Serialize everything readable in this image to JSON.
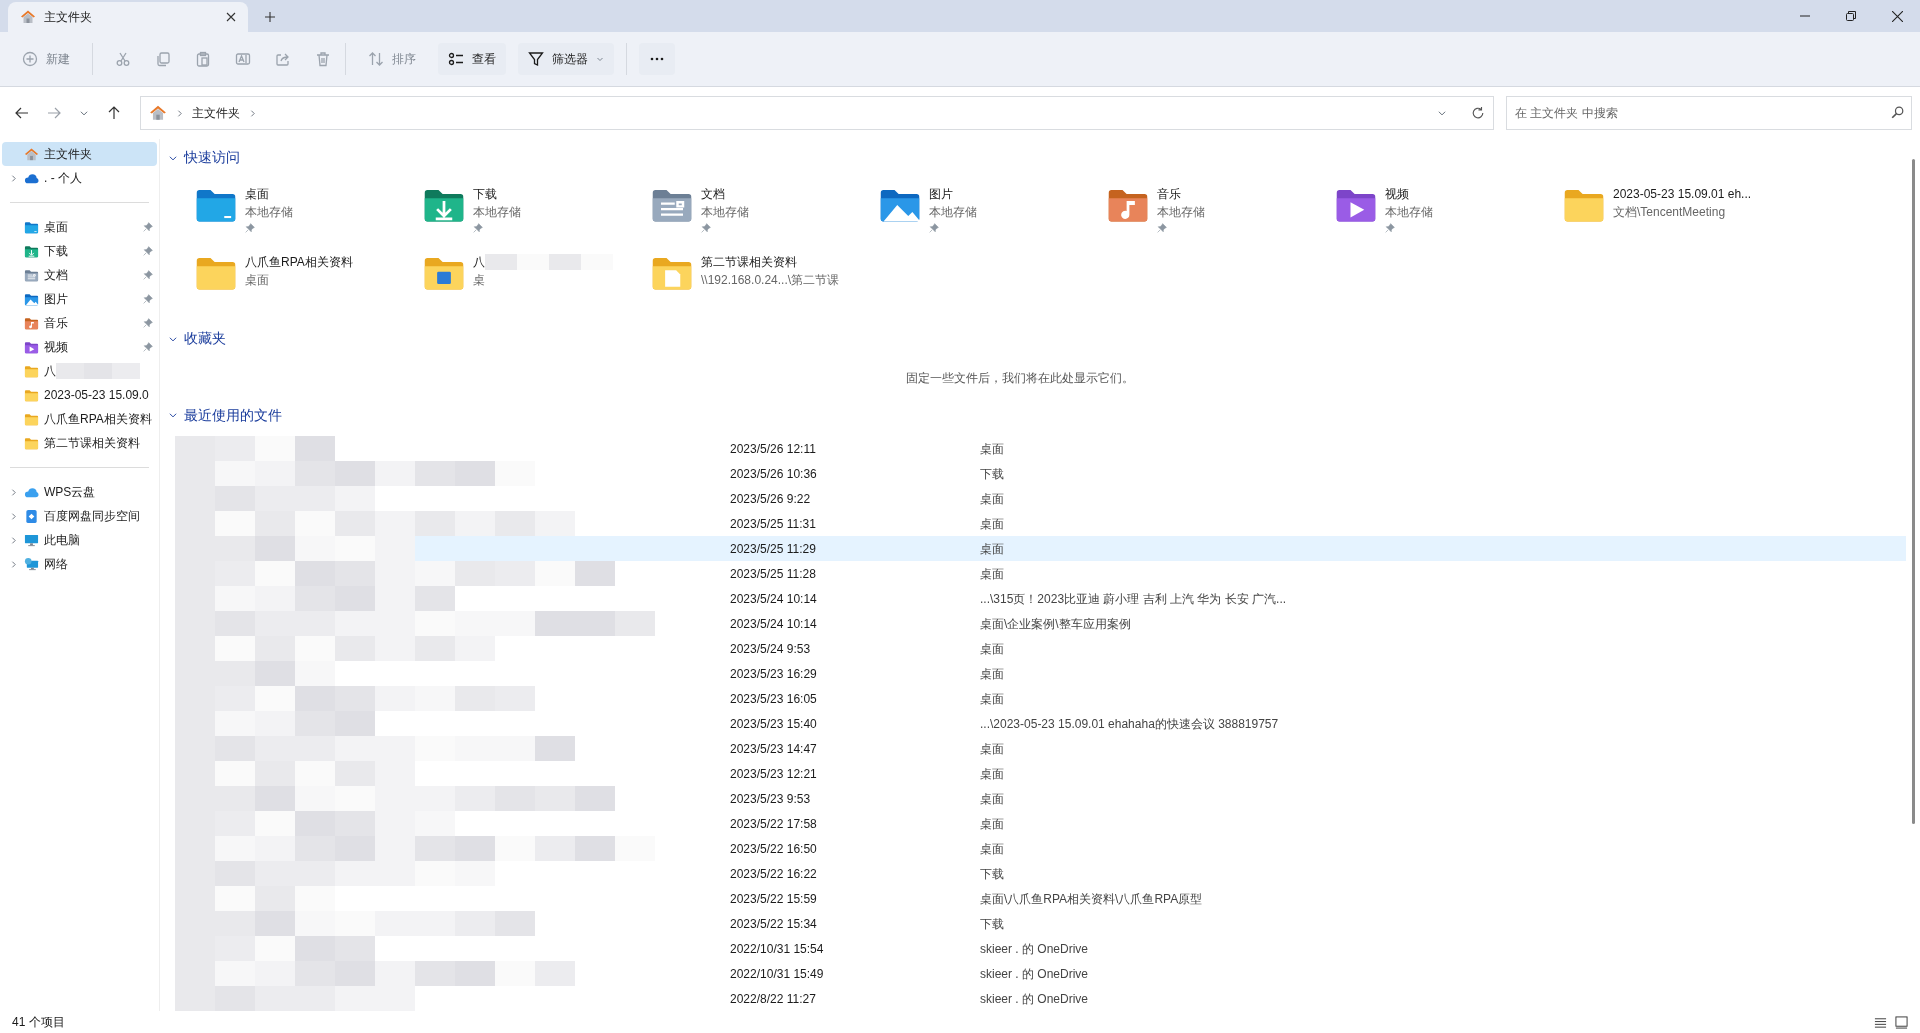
{
  "tab": {
    "title": "主文件夹",
    "selected": true
  },
  "toolbar": {
    "buttons": [
      {
        "kind": "new",
        "label": "新建",
        "disabled": true
      },
      {
        "kind": "cut",
        "disabled": true
      },
      {
        "kind": "copy",
        "disabled": true
      },
      {
        "kind": "paste",
        "disabled": true
      },
      {
        "kind": "rename",
        "disabled": true
      },
      {
        "kind": "share",
        "disabled": true
      },
      {
        "kind": "delete",
        "disabled": true
      },
      {
        "kind": "sort",
        "label": "排序",
        "disabled": true
      },
      {
        "kind": "view",
        "label": "查看",
        "disabled": false
      },
      {
        "kind": "filter",
        "label": "筛选器",
        "disabled": false
      },
      {
        "kind": "more",
        "disabled": false
      }
    ]
  },
  "address": {
    "path": [
      "主文件夹"
    ],
    "search_placeholder": "在 主文件夹 中搜索"
  },
  "sidebar": {
    "groups": [
      [
        {
          "kind": "home",
          "label": "主文件夹",
          "selected": true,
          "expandable": false,
          "pinned": false
        },
        {
          "kind": "cloud",
          "label": ". - 个人",
          "selected": false,
          "expandable": true,
          "pinned": false
        }
      ],
      [
        {
          "kind": "desktop",
          "label": "桌面",
          "selected": false,
          "expandable": false,
          "pinned": true
        },
        {
          "kind": "download",
          "label": "下载",
          "selected": false,
          "expandable": false,
          "pinned": true
        },
        {
          "kind": "docs",
          "label": "文档",
          "selected": false,
          "expandable": false,
          "pinned": true
        },
        {
          "kind": "pictures",
          "label": "图片",
          "selected": false,
          "expandable": false,
          "pinned": true
        },
        {
          "kind": "music",
          "label": "音乐",
          "selected": false,
          "expandable": false,
          "pinned": true
        },
        {
          "kind": "video",
          "label": "视频",
          "selected": false,
          "expandable": false,
          "pinned": true
        },
        {
          "kind": "folder",
          "label": "八",
          "selected": false,
          "expandable": false,
          "pinned": false,
          "blurred": true
        },
        {
          "kind": "folder",
          "label": "2023-05-23 15.09.0",
          "selected": false,
          "expandable": false,
          "pinned": false
        },
        {
          "kind": "folder",
          "label": "八爪鱼RPA相关资料",
          "selected": false,
          "expandable": false,
          "pinned": false
        },
        {
          "kind": "folder",
          "label": "第二节课相关资料",
          "selected": false,
          "expandable": false,
          "pinned": false
        }
      ],
      [
        {
          "kind": "wps",
          "label": "WPS云盘",
          "selected": false,
          "expandable": true,
          "pinned": false
        },
        {
          "kind": "baidu",
          "label": "百度网盘同步空间",
          "selected": false,
          "expandable": true,
          "pinned": false
        },
        {
          "kind": "pc",
          "label": "此电脑",
          "selected": false,
          "expandable": true,
          "pinned": false
        },
        {
          "kind": "network",
          "label": "网络",
          "selected": false,
          "expandable": true,
          "pinned": false
        }
      ]
    ]
  },
  "quick_access": {
    "title": "快速访问",
    "expanded": true,
    "items": [
      {
        "kind": "desktop",
        "name": "桌面",
        "location": "本地存储",
        "pinned": true
      },
      {
        "kind": "download",
        "name": "下载",
        "location": "本地存储",
        "pinned": true
      },
      {
        "kind": "docs",
        "name": "文档",
        "location": "本地存储",
        "pinned": true
      },
      {
        "kind": "pictures",
        "name": "图片",
        "location": "本地存储",
        "pinned": true
      },
      {
        "kind": "music",
        "name": "音乐",
        "location": "本地存储",
        "pinned": true
      },
      {
        "kind": "video",
        "name": "视频",
        "location": "本地存储",
        "pinned": true
      },
      {
        "kind": "folder",
        "name": "2023-05-23 15.09.01 eh...",
        "location": "文档\\TencentMeeting",
        "pinned": false
      },
      {
        "kind": "folder",
        "name": "八爪鱼RPA相关资料",
        "location": "桌面",
        "pinned": false
      },
      {
        "kind": "folder-app",
        "name": "八",
        "location": "桌",
        "pinned": false,
        "blurred": true
      },
      {
        "kind": "folder-doc",
        "name": "第二节课相关资料",
        "location": "\\\\192.168.0.24...\\第二节课",
        "pinned": false
      }
    ]
  },
  "favorites": {
    "title": "收藏夹",
    "expanded": true,
    "empty_message": "固定一些文件后，我们将在此处显示它们。"
  },
  "recent": {
    "title": "最近使用的文件",
    "expanded": true,
    "rows": [
      {
        "date": "2023/5/26 12:11",
        "location": "桌面",
        "selected": false
      },
      {
        "date": "2023/5/26 10:36",
        "location": "下载",
        "selected": false
      },
      {
        "date": "2023/5/26 9:22",
        "location": "桌面",
        "selected": false
      },
      {
        "date": "2023/5/25 11:31",
        "location": "桌面",
        "selected": false
      },
      {
        "date": "2023/5/25 11:29",
        "location": "桌面",
        "selected": true
      },
      {
        "date": "2023/5/25 11:28",
        "location": "桌面",
        "selected": false
      },
      {
        "date": "2023/5/24 10:14",
        "location": "...\\315页！2023比亚迪 蔚小理 吉利 上汽 华为 长安 广汽...",
        "selected": false
      },
      {
        "date": "2023/5/24 10:14",
        "location": "桌面\\企业案例\\整车应用案例",
        "selected": false
      },
      {
        "date": "2023/5/24 9:53",
        "location": "桌面",
        "selected": false
      },
      {
        "date": "2023/5/23 16:29",
        "location": "桌面",
        "selected": false
      },
      {
        "date": "2023/5/23 16:05",
        "location": "桌面",
        "selected": false
      },
      {
        "date": "2023/5/23 15:40",
        "location": "...\\2023-05-23 15.09.01 ehahaha的快速会议 388819757",
        "selected": false
      },
      {
        "date": "2023/5/23 14:47",
        "location": "桌面",
        "selected": false
      },
      {
        "date": "2023/5/23 12:21",
        "location": "桌面",
        "selected": false
      },
      {
        "date": "2023/5/23 9:53",
        "location": "桌面",
        "selected": false
      },
      {
        "date": "2023/5/22 17:58",
        "location": "桌面",
        "selected": false
      },
      {
        "date": "2023/5/22 16:50",
        "location": "桌面",
        "selected": false
      },
      {
        "date": "2023/5/22 16:22",
        "location": "下载",
        "selected": false
      },
      {
        "date": "2023/5/22 15:59",
        "location": "桌面\\八爪鱼RPA相关资料\\八爪鱼RPA原型",
        "selected": false
      },
      {
        "date": "2023/5/22 15:34",
        "location": "下载",
        "selected": false
      },
      {
        "date": "2022/10/31 15:54",
        "location": "skieer . 的 OneDrive",
        "selected": false
      },
      {
        "date": "2022/10/31 15:49",
        "location": "skieer . 的 OneDrive",
        "selected": false
      },
      {
        "date": "2022/8/22 11:27",
        "location": "skieer . 的 OneDrive",
        "selected": false
      }
    ]
  },
  "status_bar": {
    "item_count": "41 个项目"
  }
}
